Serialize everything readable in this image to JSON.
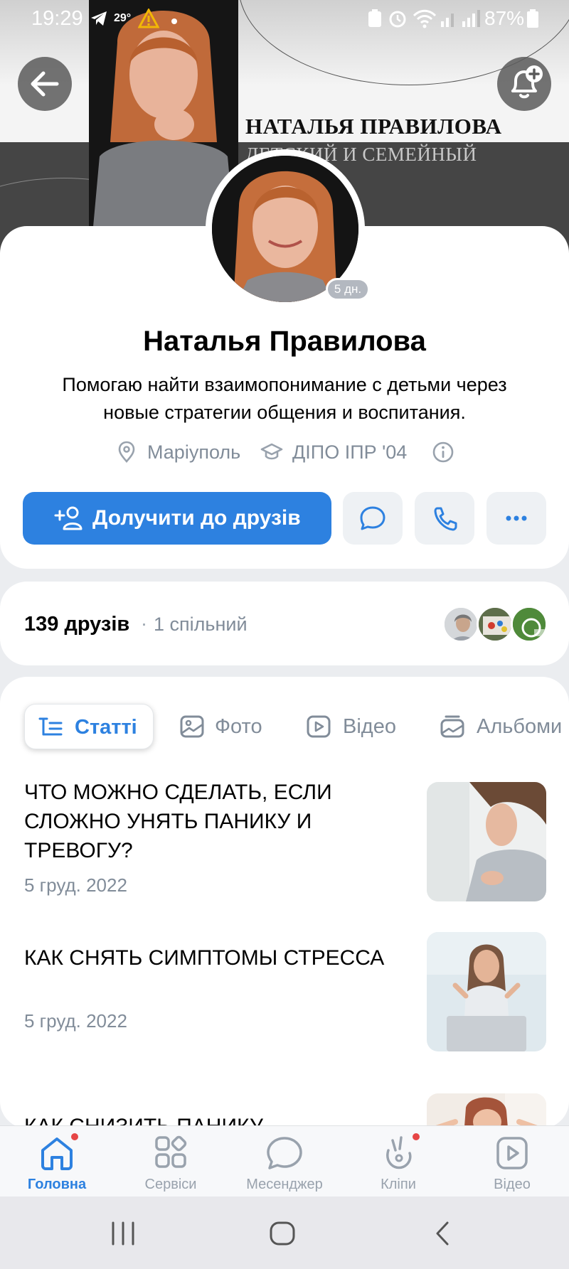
{
  "status_bar": {
    "time": "19:29",
    "temperature": "29°",
    "battery": "87%"
  },
  "cover": {
    "name": "НАТАЛЬЯ ПРАВИЛОВА",
    "subtitle": "ДЕТСКИЙ И СЕМЕЙНЫЙ"
  },
  "profile": {
    "name": "Наталья Правилова",
    "status_text_line1": "Помогаю найти взаимопонимание с детьми через",
    "status_text_line2": "новые стратегии общения и воспитания.",
    "online_ago": "5 дн.",
    "city": "Маріуполь",
    "education": "ДІПО ІПР '04",
    "add_friend_label": "Долучити до друзів"
  },
  "friends": {
    "count_label": "139 друзів",
    "separator": "·",
    "mutual_label": "1 спільний"
  },
  "tabs": [
    {
      "label": "Статті",
      "active": true
    },
    {
      "label": "Фото",
      "active": false
    },
    {
      "label": "Відео",
      "active": false
    },
    {
      "label": "Альбоми",
      "active": false
    }
  ],
  "articles": [
    {
      "title": "ЧТО МОЖНО СДЕЛАТЬ, ЕСЛИ СЛОЖНО УНЯТЬ ПАНИКУ И ТРЕВОГУ?",
      "date": "5 груд. 2022"
    },
    {
      "title": "КАК СНЯТЬ СИМПТОМЫ СТРЕССА",
      "date": "5 груд. 2022"
    },
    {
      "title": "КАК СНИЗИТЬ ПАНИКУ",
      "date": ""
    }
  ],
  "bottom_nav": [
    {
      "label": "Головна",
      "icon": "home-icon",
      "active": true,
      "badge": true
    },
    {
      "label": "Сервіси",
      "icon": "services-grid-icon",
      "active": false,
      "badge": false
    },
    {
      "label": "Месенджер",
      "icon": "messenger-icon",
      "active": false,
      "badge": false
    },
    {
      "label": "Кліпи",
      "icon": "clips-icon",
      "active": false,
      "badge": true
    },
    {
      "label": "Відео",
      "icon": "video-icon",
      "active": false,
      "badge": false
    }
  ],
  "colors": {
    "accent": "#2d81e0",
    "secondary_text": "#818c99",
    "badge_red": "#e64646"
  }
}
